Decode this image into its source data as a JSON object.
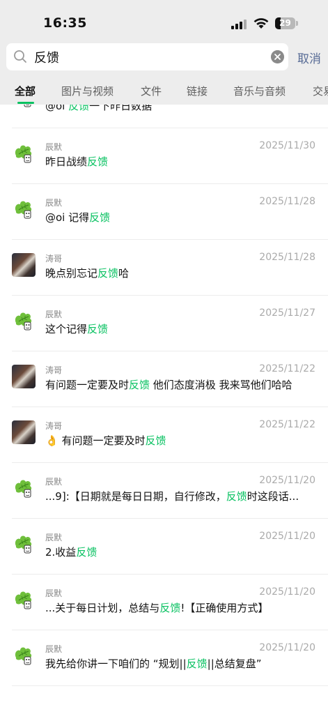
{
  "status_bar": {
    "time": "16:35",
    "battery": "29",
    "battery_level": 0.29
  },
  "search": {
    "query": "反馈",
    "cancel_label": "取消"
  },
  "tabs": [
    "全部",
    "图片与视频",
    "文件",
    "链接",
    "音乐与音频",
    "交易"
  ],
  "results": [
    {
      "sender": "",
      "date": "",
      "text_before": "@oi ",
      "highlight": "反馈",
      "text_after": "一下昨日数据",
      "avatar": "leaf"
    },
    {
      "sender": "辰默",
      "date": "2025/11/30",
      "text_before": "昨日战绩",
      "highlight": "反馈",
      "text_after": "",
      "avatar": "leaf"
    },
    {
      "sender": "辰默",
      "date": "2025/11/28",
      "text_before": "@oi 记得",
      "highlight": "反馈",
      "text_after": "",
      "avatar": "leaf"
    },
    {
      "sender": "涛哥",
      "date": "2025/11/28",
      "text_before": "晚点别忘记",
      "highlight": "反馈",
      "text_after": "哈",
      "avatar": "photo"
    },
    {
      "sender": "辰默",
      "date": "2025/11/27",
      "text_before": "这个记得",
      "highlight": "反馈",
      "text_after": "",
      "avatar": "leaf"
    },
    {
      "sender": "涛哥",
      "date": "2025/11/22",
      "text_before": "有问题一定要及时",
      "highlight": "反馈",
      "text_after": " 他们态度消极 我来骂他们哈哈",
      "avatar": "photo"
    },
    {
      "sender": "涛哥",
      "date": "2025/11/22",
      "text_before": "👌 有问题一定要及时",
      "highlight": "反馈",
      "text_after": "",
      "avatar": "photo"
    },
    {
      "sender": "辰默",
      "date": "2025/11/20",
      "text_before": "...9]:【日期就是每日日期，自行修改，",
      "highlight": "反馈",
      "text_after": "时这段话...",
      "avatar": "leaf"
    },
    {
      "sender": "辰默",
      "date": "2025/11/20",
      "text_before": "2.收益",
      "highlight": "反馈",
      "text_after": "",
      "avatar": "leaf"
    },
    {
      "sender": "辰默",
      "date": "2025/11/20",
      "text_before": "...关于每日计划，总结与",
      "highlight": "反馈",
      "text_after": "!【正确使用方式】",
      "avatar": "leaf"
    },
    {
      "sender": "辰默",
      "date": "2025/11/20",
      "text_before": "我先给你讲一下咱们的 “规划||",
      "highlight": "反馈",
      "text_after": "||总结复盘”",
      "avatar": "leaf"
    }
  ],
  "colors": {
    "highlight": "#07c160",
    "cancel": "#576b95",
    "header_bg": "#ededed"
  }
}
